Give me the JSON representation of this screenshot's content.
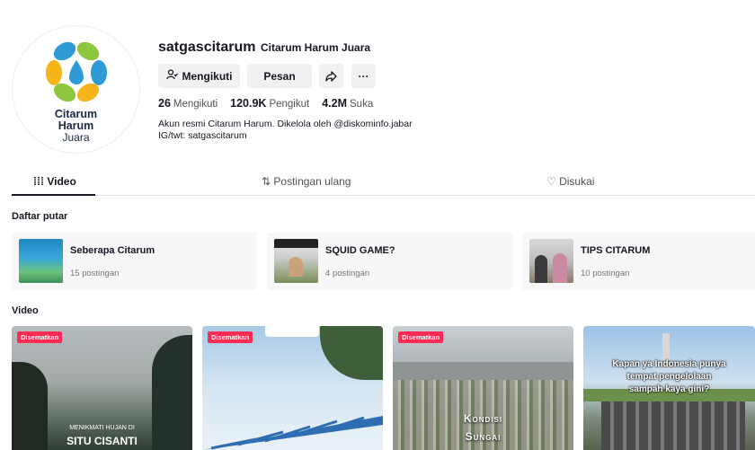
{
  "profile": {
    "logo_lines": [
      "Citarum",
      "Harum",
      "Juara"
    ],
    "username": "satgascitarum",
    "nickname": "Citarum Harum Juara",
    "follow_label": "Mengikuti",
    "message_label": "Pesan",
    "more_label": "···",
    "stats": [
      {
        "value": "26",
        "label": "Mengikuti"
      },
      {
        "value": "120.9K",
        "label": "Pengikut"
      },
      {
        "value": "4.2M",
        "label": "Suka"
      }
    ],
    "bio_line1": "Akun resmi Citarum Harum. Dikelola oleh @diskominfo.jabar",
    "bio_line2": "IG/twt: satgascitarum"
  },
  "tabs": {
    "video": "Video",
    "repost": "Postingan ulang",
    "liked": "Disukai"
  },
  "sections": {
    "playlist_title": "Daftar putar",
    "video_title": "Video"
  },
  "playlists": [
    {
      "name": "Seberapa Citarum",
      "count": "15 postingan"
    },
    {
      "name": "SQUID GAME?",
      "count": "4 postingan"
    },
    {
      "name": "TIPS CITARUM",
      "count": "10 postingan"
    }
  ],
  "videos": [
    {
      "badge": "Disematkan",
      "line1": "MENIKMATI HUJAN DI",
      "line2": "SITU CISANTI"
    },
    {
      "badge": "Disematkan",
      "line1": "",
      "line2": ""
    },
    {
      "badge": "Disematkan",
      "line1": "Kondisi",
      "line2": "Sungai"
    },
    {
      "badge": "",
      "line1": "Kapan ya Indonesia punya",
      "line2": "tempat pengelolaan",
      "line3": "sampah kaya gini?"
    }
  ],
  "colors": {
    "accent": "#fe2c55",
    "text": "#161823",
    "secondary": "#757575"
  }
}
